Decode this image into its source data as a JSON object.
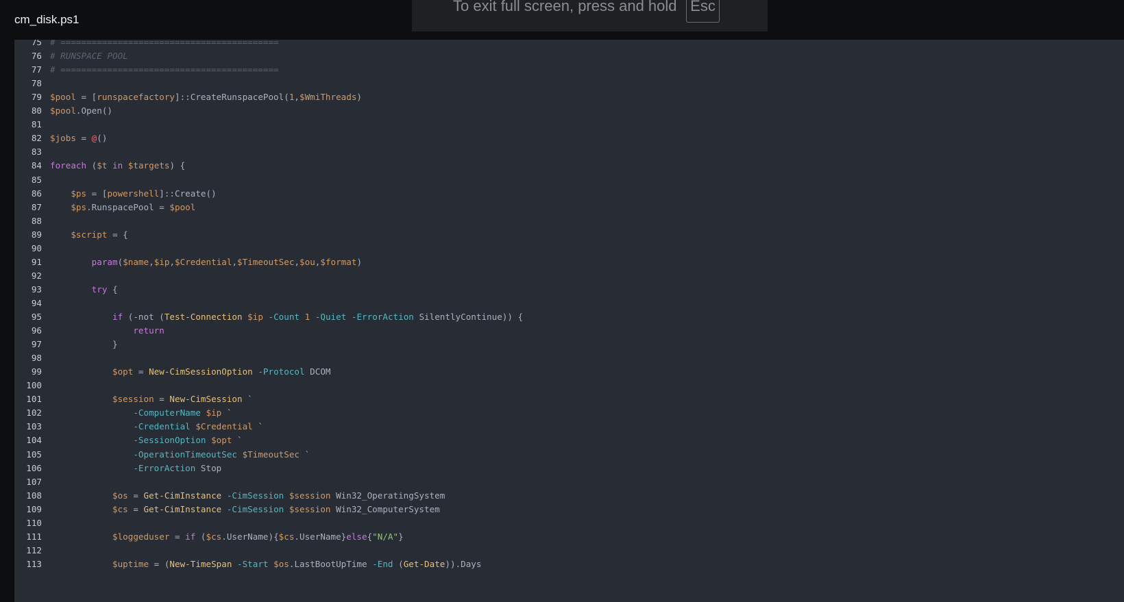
{
  "header": {
    "filename": "cm_disk.ps1"
  },
  "fullscreen_notice": {
    "text": "To exit full screen, press and hold",
    "key": "Esc"
  },
  "colors": {
    "comment": "#5c6370",
    "variable": "#d19a66",
    "keyword": "#c678dd",
    "command": "#e5c07b",
    "parameter": "#56b6c2",
    "string": "#98c379",
    "plain": "#abb2bf",
    "at": "#e06c75"
  },
  "lines": [
    {
      "n": "75",
      "tokens": [
        [
          "c-comment",
          "# =========================================="
        ]
      ]
    },
    {
      "n": "76",
      "tokens": [
        [
          "c-comment",
          "# RUNSPACE POOL"
        ]
      ]
    },
    {
      "n": "77",
      "tokens": [
        [
          "c-comment",
          "# =========================================="
        ]
      ]
    },
    {
      "n": "78",
      "tokens": []
    },
    {
      "n": "79",
      "tokens": [
        [
          "c-var",
          "$pool"
        ],
        [
          "c-plain",
          " = ["
        ],
        [
          "c-type",
          "runspacefactory"
        ],
        [
          "c-plain",
          "]::CreateRunspacePool("
        ],
        [
          "c-num",
          "1"
        ],
        [
          "c-plain",
          ","
        ],
        [
          "c-var",
          "$WmiThreads"
        ],
        [
          "c-plain",
          ")"
        ]
      ]
    },
    {
      "n": "80",
      "tokens": [
        [
          "c-var",
          "$pool"
        ],
        [
          "c-plain",
          ".Open()"
        ]
      ]
    },
    {
      "n": "81",
      "tokens": []
    },
    {
      "n": "82",
      "tokens": [
        [
          "c-var",
          "$jobs"
        ],
        [
          "c-plain",
          " = "
        ],
        [
          "c-at",
          "@"
        ],
        [
          "c-plain",
          "()"
        ]
      ]
    },
    {
      "n": "83",
      "tokens": []
    },
    {
      "n": "84",
      "tokens": [
        [
          "c-kw",
          "foreach"
        ],
        [
          "c-plain",
          " ("
        ],
        [
          "c-var",
          "$t"
        ],
        [
          "c-plain",
          " "
        ],
        [
          "c-kw",
          "in"
        ],
        [
          "c-plain",
          " "
        ],
        [
          "c-var",
          "$targets"
        ],
        [
          "c-plain",
          ") {"
        ]
      ]
    },
    {
      "n": "85",
      "tokens": []
    },
    {
      "n": "86",
      "tokens": [
        [
          "c-plain",
          "    "
        ],
        [
          "c-var",
          "$ps"
        ],
        [
          "c-plain",
          " = ["
        ],
        [
          "c-type",
          "powershell"
        ],
        [
          "c-plain",
          "]::Create()"
        ]
      ]
    },
    {
      "n": "87",
      "tokens": [
        [
          "c-plain",
          "    "
        ],
        [
          "c-var",
          "$ps"
        ],
        [
          "c-plain",
          ".RunspacePool = "
        ],
        [
          "c-var",
          "$pool"
        ]
      ]
    },
    {
      "n": "88",
      "tokens": []
    },
    {
      "n": "89",
      "tokens": [
        [
          "c-plain",
          "    "
        ],
        [
          "c-var",
          "$script"
        ],
        [
          "c-plain",
          " = {"
        ]
      ]
    },
    {
      "n": "90",
      "tokens": []
    },
    {
      "n": "91",
      "tokens": [
        [
          "c-plain",
          "        "
        ],
        [
          "c-kw",
          "param"
        ],
        [
          "c-plain",
          "("
        ],
        [
          "c-var",
          "$name"
        ],
        [
          "c-plain",
          ","
        ],
        [
          "c-var",
          "$ip"
        ],
        [
          "c-plain",
          ","
        ],
        [
          "c-var",
          "$Credential"
        ],
        [
          "c-plain",
          ","
        ],
        [
          "c-var",
          "$TimeoutSec"
        ],
        [
          "c-plain",
          ","
        ],
        [
          "c-var",
          "$ou"
        ],
        [
          "c-plain",
          ","
        ],
        [
          "c-var",
          "$format"
        ],
        [
          "c-plain",
          ")"
        ]
      ]
    },
    {
      "n": "92",
      "tokens": []
    },
    {
      "n": "93",
      "tokens": [
        [
          "c-plain",
          "        "
        ],
        [
          "c-kw",
          "try"
        ],
        [
          "c-plain",
          " {"
        ]
      ]
    },
    {
      "n": "94",
      "tokens": []
    },
    {
      "n": "95",
      "tokens": [
        [
          "c-plain",
          "            "
        ],
        [
          "c-kw",
          "if"
        ],
        [
          "c-plain",
          " (-not ("
        ],
        [
          "c-cmd",
          "Test-Connection"
        ],
        [
          "c-plain",
          " "
        ],
        [
          "c-var",
          "$ip"
        ],
        [
          "c-plain",
          " "
        ],
        [
          "c-param",
          "-Count"
        ],
        [
          "c-plain",
          " "
        ],
        [
          "c-num",
          "1"
        ],
        [
          "c-plain",
          " "
        ],
        [
          "c-param",
          "-Quiet"
        ],
        [
          "c-plain",
          " "
        ],
        [
          "c-param",
          "-ErrorAction"
        ],
        [
          "c-plain",
          " SilentlyContinue)) {"
        ]
      ]
    },
    {
      "n": "96",
      "tokens": [
        [
          "c-plain",
          "                "
        ],
        [
          "c-kw",
          "return"
        ]
      ]
    },
    {
      "n": "97",
      "tokens": [
        [
          "c-plain",
          "            }"
        ]
      ]
    },
    {
      "n": "98",
      "tokens": []
    },
    {
      "n": "99",
      "tokens": [
        [
          "c-plain",
          "            "
        ],
        [
          "c-var",
          "$opt"
        ],
        [
          "c-plain",
          " = "
        ],
        [
          "c-cmd",
          "New-CimSessionOption"
        ],
        [
          "c-plain",
          " "
        ],
        [
          "c-param",
          "-Protocol"
        ],
        [
          "c-plain",
          " DCOM"
        ]
      ]
    },
    {
      "n": "100",
      "tokens": []
    },
    {
      "n": "101",
      "tokens": [
        [
          "c-plain",
          "            "
        ],
        [
          "c-var",
          "$session"
        ],
        [
          "c-plain",
          " = "
        ],
        [
          "c-cmd",
          "New-CimSession"
        ],
        [
          "c-plain",
          " `"
        ]
      ]
    },
    {
      "n": "102",
      "tokens": [
        [
          "c-plain",
          "                "
        ],
        [
          "c-param",
          "-ComputerName"
        ],
        [
          "c-plain",
          " "
        ],
        [
          "c-var",
          "$ip"
        ],
        [
          "c-plain",
          " `"
        ]
      ]
    },
    {
      "n": "103",
      "tokens": [
        [
          "c-plain",
          "                "
        ],
        [
          "c-param",
          "-Credential"
        ],
        [
          "c-plain",
          " "
        ],
        [
          "c-var",
          "$Credential"
        ],
        [
          "c-plain",
          " `"
        ]
      ]
    },
    {
      "n": "104",
      "tokens": [
        [
          "c-plain",
          "                "
        ],
        [
          "c-param",
          "-SessionOption"
        ],
        [
          "c-plain",
          " "
        ],
        [
          "c-var",
          "$opt"
        ],
        [
          "c-plain",
          " `"
        ]
      ]
    },
    {
      "n": "105",
      "tokens": [
        [
          "c-plain",
          "                "
        ],
        [
          "c-param",
          "-OperationTimeoutSec"
        ],
        [
          "c-plain",
          " "
        ],
        [
          "c-var",
          "$TimeoutSec"
        ],
        [
          "c-plain",
          " `"
        ]
      ]
    },
    {
      "n": "106",
      "tokens": [
        [
          "c-plain",
          "                "
        ],
        [
          "c-param",
          "-ErrorAction"
        ],
        [
          "c-plain",
          " Stop"
        ]
      ]
    },
    {
      "n": "107",
      "tokens": []
    },
    {
      "n": "108",
      "tokens": [
        [
          "c-plain",
          "            "
        ],
        [
          "c-var",
          "$os"
        ],
        [
          "c-plain",
          " = "
        ],
        [
          "c-cmd",
          "Get-CimInstance"
        ],
        [
          "c-plain",
          " "
        ],
        [
          "c-param",
          "-CimSession"
        ],
        [
          "c-plain",
          " "
        ],
        [
          "c-var",
          "$session"
        ],
        [
          "c-plain",
          " Win32_OperatingSystem"
        ]
      ]
    },
    {
      "n": "109",
      "tokens": [
        [
          "c-plain",
          "            "
        ],
        [
          "c-var",
          "$cs"
        ],
        [
          "c-plain",
          " = "
        ],
        [
          "c-cmd",
          "Get-CimInstance"
        ],
        [
          "c-plain",
          " "
        ],
        [
          "c-param",
          "-CimSession"
        ],
        [
          "c-plain",
          " "
        ],
        [
          "c-var",
          "$session"
        ],
        [
          "c-plain",
          " Win32_ComputerSystem"
        ]
      ]
    },
    {
      "n": "110",
      "tokens": []
    },
    {
      "n": "111",
      "tokens": [
        [
          "c-plain",
          "            "
        ],
        [
          "c-var",
          "$loggeduser"
        ],
        [
          "c-plain",
          " = "
        ],
        [
          "c-kw",
          "if"
        ],
        [
          "c-plain",
          " ("
        ],
        [
          "c-var",
          "$cs"
        ],
        [
          "c-plain",
          ".UserName){"
        ],
        [
          "c-var",
          "$cs"
        ],
        [
          "c-plain",
          ".UserName}"
        ],
        [
          "c-kw",
          "else"
        ],
        [
          "c-plain",
          "{"
        ],
        [
          "c-str",
          "\"N/A\""
        ],
        [
          "c-plain",
          "}"
        ]
      ]
    },
    {
      "n": "112",
      "tokens": []
    },
    {
      "n": "113",
      "tokens": [
        [
          "c-plain",
          "            "
        ],
        [
          "c-var",
          "$uptime"
        ],
        [
          "c-plain",
          " = ("
        ],
        [
          "c-cmd",
          "New-TimeSpan"
        ],
        [
          "c-plain",
          " "
        ],
        [
          "c-param",
          "-Start"
        ],
        [
          "c-plain",
          " "
        ],
        [
          "c-var",
          "$os"
        ],
        [
          "c-plain",
          ".LastBootUpTime "
        ],
        [
          "c-param",
          "-End"
        ],
        [
          "c-plain",
          " ("
        ],
        [
          "c-cmd",
          "Get-Date"
        ],
        [
          "c-plain",
          ")).Days"
        ]
      ]
    }
  ]
}
